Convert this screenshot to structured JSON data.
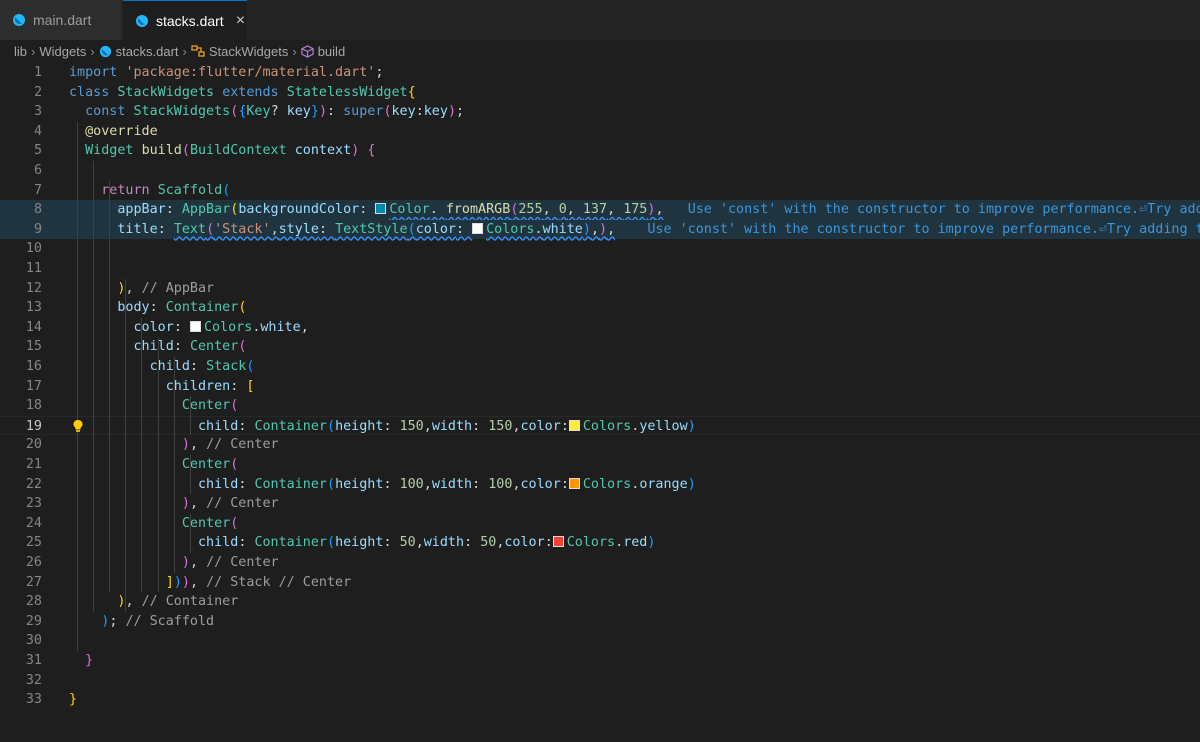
{
  "tabs": [
    {
      "label": "main.dart",
      "active": false
    },
    {
      "label": "stacks.dart",
      "active": true,
      "close_icon": "×"
    }
  ],
  "breadcrumb": [
    "lib",
    "Widgets",
    "stacks.dart",
    "StackWidgets",
    "build"
  ],
  "icons": {
    "file": "dart-icon",
    "class": "class-icon",
    "method": "method-icon",
    "lightbulb": "lightbulb-icon"
  },
  "colors": {
    "accent": "#0078d4",
    "yellow": "#ffeb3b",
    "orange": "#ff9800",
    "red": "#f44336",
    "teal": "#0089af",
    "white": "#ffffff"
  },
  "editor": {
    "current_line": 19,
    "lines": [
      {
        "n": "1",
        "t": [
          [
            "kw",
            "import "
          ],
          [
            "str",
            "'package:flutter/material.dart'"
          ],
          [
            "",
            "; "
          ]
        ]
      },
      {
        "n": "2",
        "t": [
          [
            "kw",
            "class "
          ],
          [
            "ty",
            "StackWidgets "
          ],
          [
            "kw",
            "extends "
          ],
          [
            "ty",
            "StatelessWidget"
          ],
          [
            "b1",
            "{"
          ]
        ]
      },
      {
        "n": "3",
        "t": [
          [
            "",
            "  "
          ],
          [
            "kw",
            "const "
          ],
          [
            "ty",
            "StackWidgets"
          ],
          [
            "b2",
            "("
          ],
          [
            "b3",
            "{"
          ],
          [
            "ty",
            "Key"
          ],
          [
            "",
            "? "
          ],
          [
            "pr",
            "key"
          ],
          [
            "b3",
            "}"
          ],
          [
            "b2",
            ")"
          ],
          [
            "",
            ": "
          ],
          [
            "kw",
            "super"
          ],
          [
            "b2",
            "("
          ],
          [
            "pr",
            "key"
          ],
          [
            "",
            ":"
          ],
          [
            "pr",
            "key"
          ],
          [
            "b2",
            ")"
          ],
          [
            "",
            ";"
          ]
        ]
      },
      {
        "n": "4",
        "t": [
          [
            "",
            "  "
          ],
          [
            "an",
            "@override"
          ]
        ]
      },
      {
        "n": "5",
        "t": [
          [
            "",
            "  "
          ],
          [
            "ty",
            "Widget "
          ],
          [
            "fn",
            "build"
          ],
          [
            "b2",
            "("
          ],
          [
            "ty",
            "BuildContext "
          ],
          [
            "pr",
            "context"
          ],
          [
            "b2",
            ")"
          ],
          [
            "",
            " "
          ],
          [
            "b2",
            "{"
          ]
        ]
      },
      {
        "n": "6",
        "t": []
      },
      {
        "n": "7",
        "t": [
          [
            "",
            "    "
          ],
          [
            "ctl",
            "return "
          ],
          [
            "ty",
            "Scaffold"
          ],
          [
            "b3",
            "("
          ]
        ]
      },
      {
        "n": "8",
        "t": [
          [
            "",
            "      "
          ],
          [
            "pr",
            "appBar"
          ],
          [
            "",
            ": "
          ],
          [
            "ty",
            "AppBar"
          ],
          [
            "b1",
            "("
          ],
          [
            "pr",
            "backgroundColor"
          ],
          [
            "",
            ": "
          ],
          [
            "sw",
            "teal"
          ],
          [
            "ty",
            "Color"
          ],
          [
            "",
            ". "
          ],
          [
            "fn",
            "fromARGB"
          ],
          [
            "b2",
            "("
          ],
          [
            "num",
            "255"
          ],
          [
            "",
            ", "
          ],
          [
            "num",
            "0"
          ],
          [
            "",
            ", "
          ],
          [
            "num",
            "137"
          ],
          [
            "",
            ", "
          ],
          [
            "num",
            "175"
          ],
          [
            "b2",
            ")"
          ],
          [
            "",
            ","
          ],
          [
            "",
            "   "
          ],
          [
            "hint",
            "Use 'const' with the constructor to improve performance.⏎Try adding"
          ]
        ]
      },
      {
        "n": "9",
        "t": [
          [
            "",
            "      "
          ],
          [
            "pr",
            "title"
          ],
          [
            "",
            ": "
          ],
          [
            "ty",
            "Text"
          ],
          [
            "b2",
            "("
          ],
          [
            "str",
            "'Stack'"
          ],
          [
            "",
            ","
          ],
          [
            "pr",
            "style"
          ],
          [
            "",
            ": "
          ],
          [
            "ty",
            "TextStyle"
          ],
          [
            "b3",
            "("
          ],
          [
            "pr",
            "color"
          ],
          [
            "",
            ": "
          ],
          [
            "sw",
            "white"
          ],
          [
            "ty",
            "Colors"
          ],
          [
            "",
            "."
          ],
          [
            "pr",
            "white"
          ],
          [
            "b3",
            ")"
          ],
          [
            "",
            ","
          ],
          [
            "b2",
            ")"
          ],
          [
            "",
            ","
          ],
          [
            "",
            "    "
          ],
          [
            "hint",
            "Use 'const' with the constructor to improve performance.⏎Try adding th"
          ]
        ]
      },
      {
        "n": "10",
        "t": []
      },
      {
        "n": "11",
        "t": []
      },
      {
        "n": "12",
        "t": [
          [
            "",
            "      "
          ],
          [
            "b1",
            ")"
          ],
          [
            "",
            ", "
          ],
          [
            "cm",
            "// AppBar"
          ]
        ]
      },
      {
        "n": "13",
        "t": [
          [
            "",
            "      "
          ],
          [
            "pr",
            "body"
          ],
          [
            "",
            ": "
          ],
          [
            "ty",
            "Container"
          ],
          [
            "b1",
            "("
          ]
        ]
      },
      {
        "n": "14",
        "t": [
          [
            "",
            "        "
          ],
          [
            "pr",
            "color"
          ],
          [
            "",
            ": "
          ],
          [
            "sw",
            "white"
          ],
          [
            "ty",
            "Colors"
          ],
          [
            "",
            "."
          ],
          [
            "pr",
            "white"
          ],
          [
            "",
            ","
          ]
        ]
      },
      {
        "n": "15",
        "t": [
          [
            "",
            "        "
          ],
          [
            "pr",
            "child"
          ],
          [
            "",
            ": "
          ],
          [
            "ty",
            "Center"
          ],
          [
            "b2",
            "("
          ]
        ]
      },
      {
        "n": "16",
        "t": [
          [
            "",
            "          "
          ],
          [
            "pr",
            "child"
          ],
          [
            "",
            ": "
          ],
          [
            "ty",
            "Stack"
          ],
          [
            "b3",
            "("
          ]
        ]
      },
      {
        "n": "17",
        "t": [
          [
            "",
            "            "
          ],
          [
            "pr",
            "children"
          ],
          [
            "",
            ": "
          ],
          [
            "b1",
            "["
          ]
        ]
      },
      {
        "n": "18",
        "t": [
          [
            "",
            "              "
          ],
          [
            "ty",
            "Center"
          ],
          [
            "b2",
            "("
          ]
        ]
      },
      {
        "n": "19",
        "t": [
          [
            "",
            "                "
          ],
          [
            "pr",
            "child"
          ],
          [
            "",
            ": "
          ],
          [
            "ty",
            "Container"
          ],
          [
            "b3",
            "("
          ],
          [
            "pr",
            "height"
          ],
          [
            "",
            ": "
          ],
          [
            "num",
            "150"
          ],
          [
            "",
            ","
          ],
          [
            "pr",
            "width"
          ],
          [
            "",
            ": "
          ],
          [
            "num",
            "150"
          ],
          [
            "",
            ","
          ],
          [
            "pr",
            "color"
          ],
          [
            "",
            ":"
          ],
          [
            "sw",
            "yellow"
          ],
          [
            "ty",
            "Colors"
          ],
          [
            "",
            "."
          ],
          [
            "pr",
            "yellow"
          ],
          [
            "b3",
            ")"
          ]
        ]
      },
      {
        "n": "20",
        "t": [
          [
            "",
            "              "
          ],
          [
            "b2",
            ")"
          ],
          [
            "",
            ", "
          ],
          [
            "cm",
            "// Center"
          ]
        ]
      },
      {
        "n": "21",
        "t": [
          [
            "",
            "              "
          ],
          [
            "ty",
            "Center"
          ],
          [
            "b2",
            "("
          ]
        ]
      },
      {
        "n": "22",
        "t": [
          [
            "",
            "                "
          ],
          [
            "pr",
            "child"
          ],
          [
            "",
            ": "
          ],
          [
            "ty",
            "Container"
          ],
          [
            "b3",
            "("
          ],
          [
            "pr",
            "height"
          ],
          [
            "",
            ": "
          ],
          [
            "num",
            "100"
          ],
          [
            "",
            ","
          ],
          [
            "pr",
            "width"
          ],
          [
            "",
            ": "
          ],
          [
            "num",
            "100"
          ],
          [
            "",
            ","
          ],
          [
            "pr",
            "color"
          ],
          [
            "",
            ":"
          ],
          [
            "sw",
            "orange"
          ],
          [
            "ty",
            "Colors"
          ],
          [
            "",
            "."
          ],
          [
            "pr",
            "orange"
          ],
          [
            "b3",
            ")"
          ]
        ]
      },
      {
        "n": "23",
        "t": [
          [
            "",
            "              "
          ],
          [
            "b2",
            ")"
          ],
          [
            "",
            ", "
          ],
          [
            "cm",
            "// Center"
          ]
        ]
      },
      {
        "n": "24",
        "t": [
          [
            "",
            "              "
          ],
          [
            "ty",
            "Center"
          ],
          [
            "b2",
            "("
          ]
        ]
      },
      {
        "n": "25",
        "t": [
          [
            "",
            "                "
          ],
          [
            "pr",
            "child"
          ],
          [
            "",
            ": "
          ],
          [
            "ty",
            "Container"
          ],
          [
            "b3",
            "("
          ],
          [
            "pr",
            "height"
          ],
          [
            "",
            ": "
          ],
          [
            "num",
            "50"
          ],
          [
            "",
            ","
          ],
          [
            "pr",
            "width"
          ],
          [
            "",
            ": "
          ],
          [
            "num",
            "50"
          ],
          [
            "",
            ","
          ],
          [
            "pr",
            "color"
          ],
          [
            "",
            ":"
          ],
          [
            "sw",
            "red"
          ],
          [
            "ty",
            "Colors"
          ],
          [
            "",
            "."
          ],
          [
            "pr",
            "red"
          ],
          [
            "b3",
            ")"
          ]
        ]
      },
      {
        "n": "26",
        "t": [
          [
            "",
            "              "
          ],
          [
            "b2",
            ")"
          ],
          [
            "",
            ", "
          ],
          [
            "cm",
            "// Center"
          ]
        ]
      },
      {
        "n": "27",
        "t": [
          [
            "",
            "            "
          ],
          [
            "b1",
            "]"
          ],
          [
            "b3",
            ")"
          ],
          [
            "b2",
            ")"
          ],
          [
            "",
            ", "
          ],
          [
            "cm",
            "// Stack // Center"
          ]
        ]
      },
      {
        "n": "28",
        "t": [
          [
            "",
            "      "
          ],
          [
            "b1",
            ")"
          ],
          [
            "",
            ", "
          ],
          [
            "cm",
            "// Container"
          ]
        ]
      },
      {
        "n": "29",
        "t": [
          [
            "",
            "    "
          ],
          [
            "b3",
            ")"
          ],
          [
            "",
            "; "
          ],
          [
            "cm",
            "// Scaffold"
          ]
        ]
      },
      {
        "n": "30",
        "t": []
      },
      {
        "n": "31",
        "t": [
          [
            "",
            "  "
          ],
          [
            "b2",
            "}"
          ]
        ]
      },
      {
        "n": "32",
        "t": []
      },
      {
        "n": "33",
        "t": [
          [
            "b1",
            "}"
          ]
        ]
      }
    ]
  }
}
